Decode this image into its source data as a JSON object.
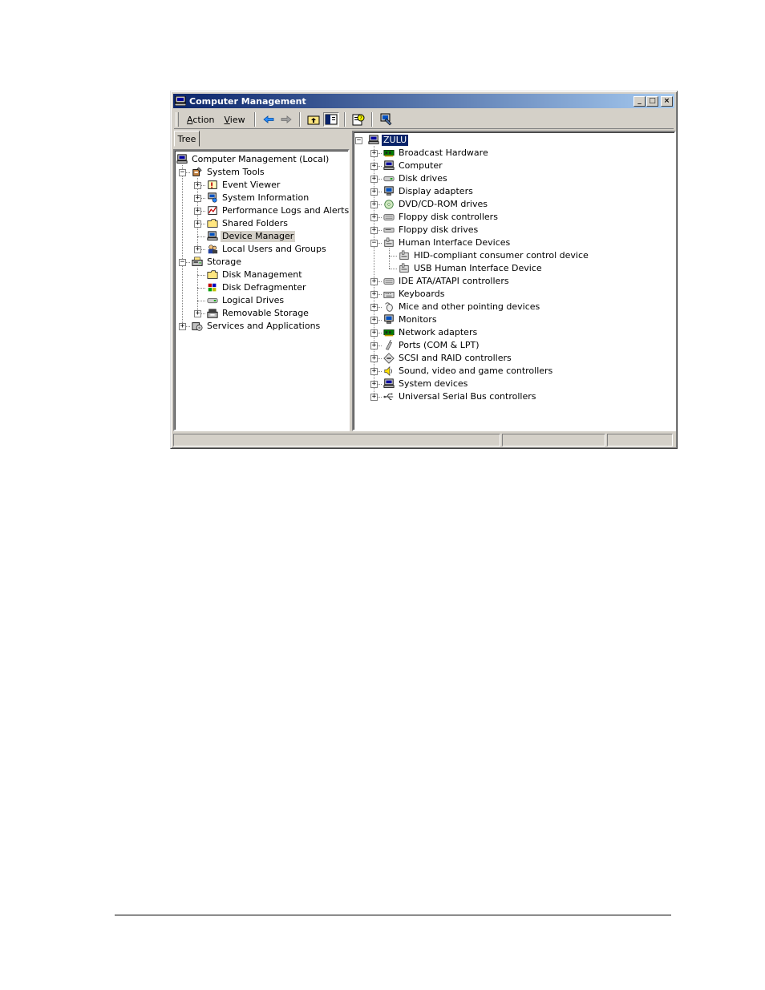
{
  "window": {
    "title": "Computer Management",
    "minimize_glyph": "_",
    "maximize_glyph": "□",
    "close_glyph": "×"
  },
  "menu": {
    "action": {
      "hotkey": "A",
      "rest": "ction"
    },
    "view": {
      "hotkey": "V",
      "rest": "iew"
    }
  },
  "toolbar_icons": [
    "back-arrow-icon",
    "forward-arrow-icon",
    "up-folder-icon",
    "show-hide-tree-icon",
    "properties-help-icon",
    "device-scan-icon"
  ],
  "left_tab": "Tree",
  "left_tree": [
    {
      "label": "Computer Management (Local)",
      "level": 0,
      "expander": "",
      "icon": "computer-icon"
    },
    {
      "label": "System Tools",
      "level": 1,
      "expander": "−",
      "icon": "tools-icon"
    },
    {
      "label": "Event Viewer",
      "level": 2,
      "expander": "+",
      "icon": "event-viewer-icon"
    },
    {
      "label": "System Information",
      "level": 2,
      "expander": "+",
      "icon": "system-info-icon"
    },
    {
      "label": "Performance Logs and Alerts",
      "level": 2,
      "expander": "+",
      "icon": "performance-icon"
    },
    {
      "label": "Shared Folders",
      "level": 2,
      "expander": "+",
      "icon": "folder-icon"
    },
    {
      "label": "Device Manager",
      "level": 2,
      "expander": "",
      "icon": "device-manager-icon",
      "highlight": true
    },
    {
      "label": "Local Users and Groups",
      "level": 2,
      "expander": "+",
      "icon": "users-icon"
    },
    {
      "label": "Storage",
      "level": 1,
      "expander": "−",
      "icon": "storage-icon"
    },
    {
      "label": "Disk Management",
      "level": 2,
      "expander": "",
      "icon": "folder-icon"
    },
    {
      "label": "Disk Defragmenter",
      "level": 2,
      "expander": "",
      "icon": "defrag-icon"
    },
    {
      "label": "Logical Drives",
      "level": 2,
      "expander": "",
      "icon": "drive-icon"
    },
    {
      "label": "Removable Storage",
      "level": 2,
      "expander": "+",
      "icon": "removable-storage-icon"
    },
    {
      "label": "Services and Applications",
      "level": 1,
      "expander": "+",
      "icon": "services-icon"
    }
  ],
  "right_tree": [
    {
      "label": "ZULU",
      "level": 0,
      "expander": "−",
      "icon": "computer-icon",
      "selected": true
    },
    {
      "label": "Broadcast Hardware",
      "level": 1,
      "expander": "+",
      "icon": "board-icon"
    },
    {
      "label": "Computer",
      "level": 1,
      "expander": "+",
      "icon": "computer-icon"
    },
    {
      "label": "Disk drives",
      "level": 1,
      "expander": "+",
      "icon": "drive-icon"
    },
    {
      "label": "Display adapters",
      "level": 1,
      "expander": "+",
      "icon": "monitor-icon"
    },
    {
      "label": "DVD/CD-ROM drives",
      "level": 1,
      "expander": "+",
      "icon": "cdrom-icon"
    },
    {
      "label": "Floppy disk controllers",
      "level": 1,
      "expander": "+",
      "icon": "controller-icon"
    },
    {
      "label": "Floppy disk drives",
      "level": 1,
      "expander": "+",
      "icon": "floppy-icon"
    },
    {
      "label": "Human Interface Devices",
      "level": 1,
      "expander": "−",
      "icon": "hid-icon"
    },
    {
      "label": "HID-compliant consumer control device",
      "level": 2,
      "expander": "",
      "icon": "hid-icon"
    },
    {
      "label": "USB Human Interface Device",
      "level": 2,
      "expander": "",
      "icon": "hid-icon"
    },
    {
      "label": "IDE ATA/ATAPI controllers",
      "level": 1,
      "expander": "+",
      "icon": "controller-icon"
    },
    {
      "label": "Keyboards",
      "level": 1,
      "expander": "+",
      "icon": "keyboard-icon"
    },
    {
      "label": "Mice and other pointing devices",
      "level": 1,
      "expander": "+",
      "icon": "mouse-icon"
    },
    {
      "label": "Monitors",
      "level": 1,
      "expander": "+",
      "icon": "monitor-icon"
    },
    {
      "label": "Network adapters",
      "level": 1,
      "expander": "+",
      "icon": "board-icon"
    },
    {
      "label": "Ports (COM & LPT)",
      "level": 1,
      "expander": "+",
      "icon": "port-icon"
    },
    {
      "label": "SCSI and RAID controllers",
      "level": 1,
      "expander": "+",
      "icon": "scsi-icon"
    },
    {
      "label": "Sound, video and game controllers",
      "level": 1,
      "expander": "+",
      "icon": "sound-icon"
    },
    {
      "label": "System devices",
      "level": 1,
      "expander": "+",
      "icon": "computer-icon"
    },
    {
      "label": "Universal Serial Bus controllers",
      "level": 1,
      "expander": "+",
      "icon": "usb-icon"
    }
  ],
  "colors": {
    "title_start": "#0a246a",
    "title_end": "#a6caf0",
    "face": "#d4d0c8",
    "selection": "#0a246a"
  }
}
